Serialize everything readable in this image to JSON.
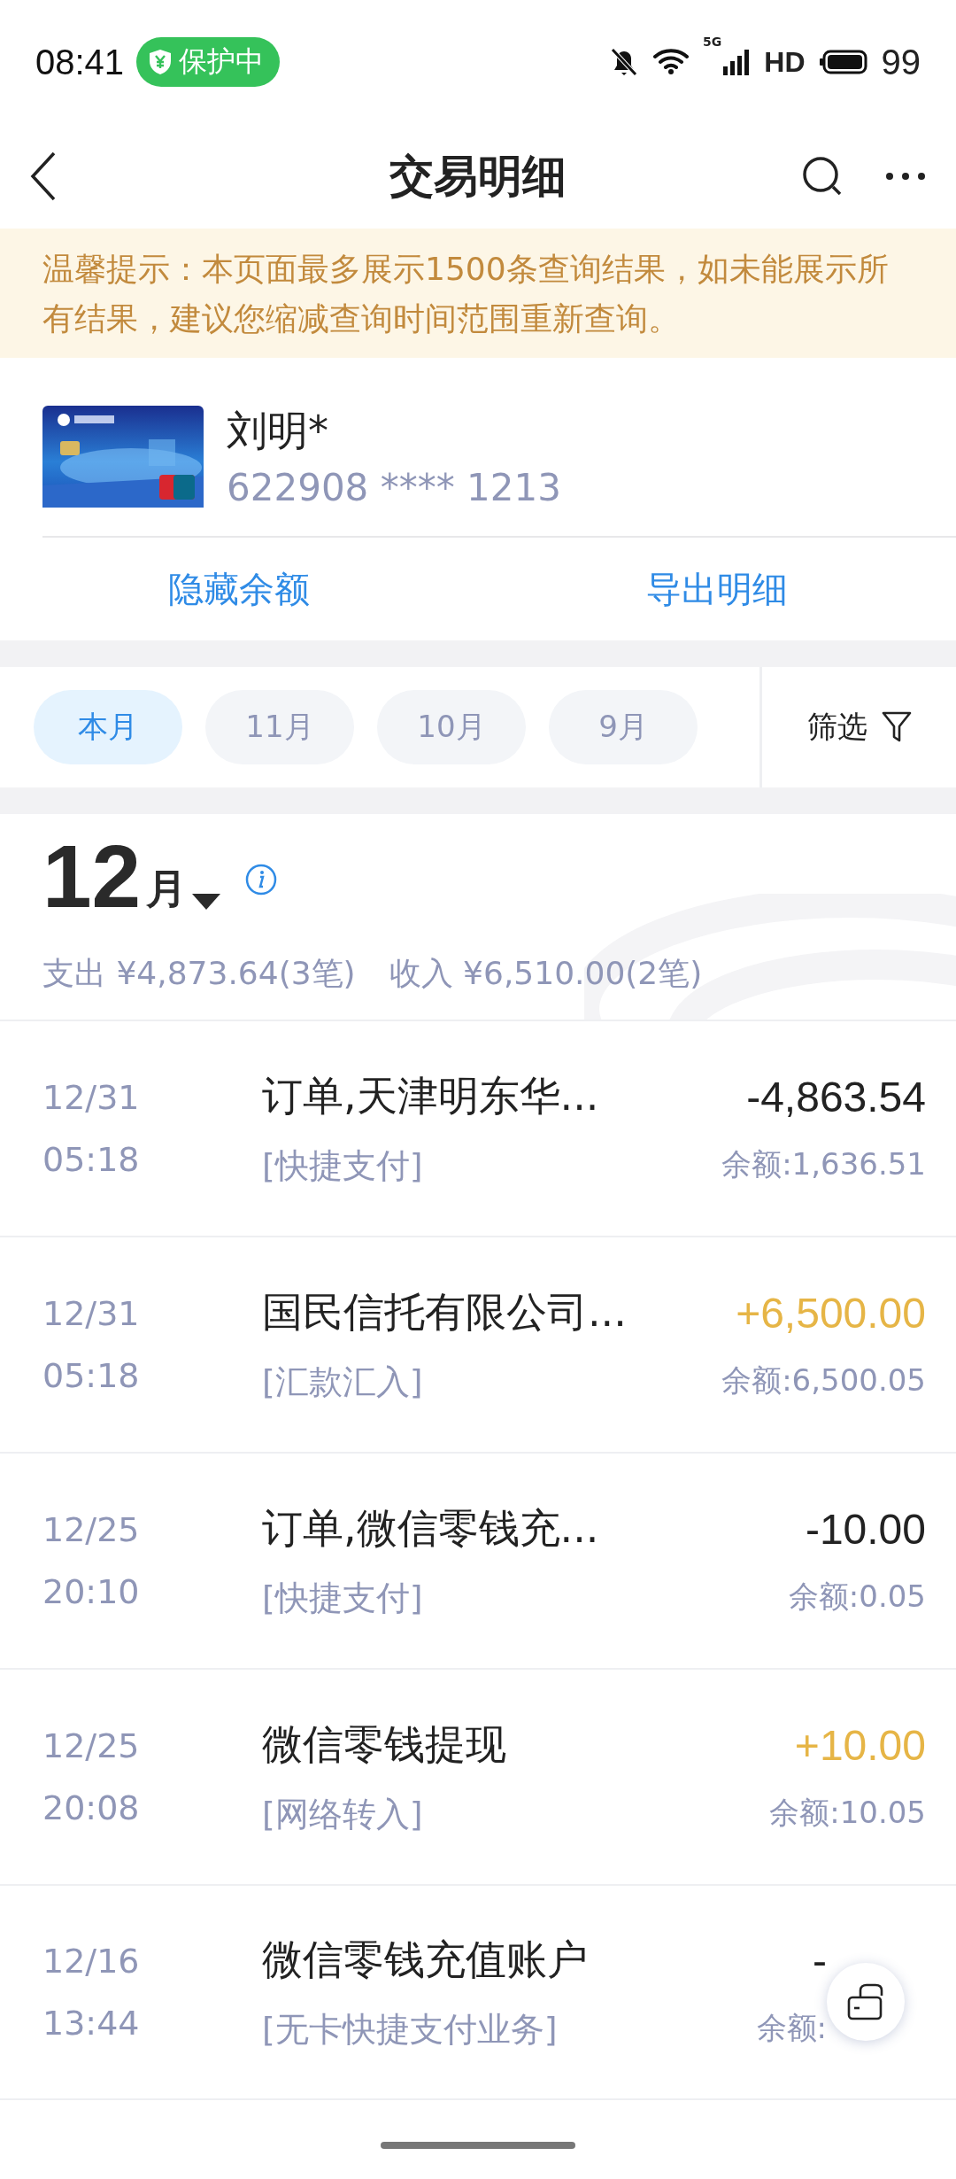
{
  "status_bar": {
    "time": "08:41",
    "badge": "保护中",
    "network": "5G",
    "hd": "HD",
    "battery": "99"
  },
  "header": {
    "title": "交易明细"
  },
  "notice": "温馨提示：本页面最多展示1500条查询结果，如未能展示所有结果，建议您缩减查询时间范围重新查询。",
  "card": {
    "holder": "刘明*",
    "number": "622908 **** 1213"
  },
  "actions": [
    "隐藏余额",
    "导出明细"
  ],
  "period_tabs": [
    {
      "label": "本月",
      "selected": true
    },
    {
      "label": "11月",
      "selected": false
    },
    {
      "label": "10月",
      "selected": false
    },
    {
      "label": "9月",
      "selected": false
    }
  ],
  "filter": "筛选",
  "month": {
    "number": "12",
    "unit": "月"
  },
  "summary": [
    "支出 ¥4,873.64(3笔)",
    "收入 ¥6,510.00(2笔)"
  ],
  "transactions": [
    {
      "date": "12/31",
      "time": "05:18",
      "title": "订单,天津明东华...",
      "channel": "[快捷支付]",
      "amount": "-4,863.54",
      "balance": "余额:1,636.51",
      "kind": "expense"
    },
    {
      "date": "12/31",
      "time": "05:18",
      "title": "国民信托有限公司...",
      "channel": "[汇款汇入]",
      "amount": "+6,500.00",
      "balance": "余额:6,500.05",
      "kind": "income"
    },
    {
      "date": "12/25",
      "time": "20:10",
      "title": "订单,微信零钱充...",
      "channel": "[快捷支付]",
      "amount": "-10.00",
      "balance": "余额:0.05",
      "kind": "expense"
    },
    {
      "date": "12/25",
      "time": "20:08",
      "title": "微信零钱提现",
      "channel": "[网络转入]",
      "amount": "+10.00",
      "balance": "余额:10.05",
      "kind": "income"
    },
    {
      "date": "12/16",
      "time": "13:44",
      "title": "微信零钱充值账户",
      "channel": "[无卡快捷支付业务]",
      "amount": "-",
      "balance": "余额:",
      "kind": "expense"
    }
  ]
}
